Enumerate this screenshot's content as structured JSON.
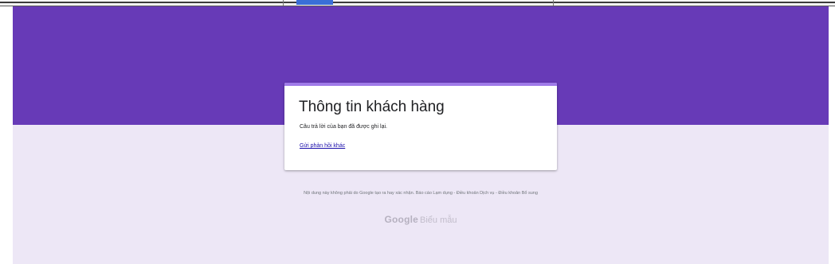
{
  "form": {
    "title": "Thông tin khách hàng",
    "confirmation_message": "Câu trả lời của bạn đã được ghi lại.",
    "resubmit_link": "Gửi phản hồi khác"
  },
  "footer": {
    "disclaimer_text": "Nội dung này không phải do Google tạo ra hay xác nhận.",
    "report_abuse": "Báo cáo Lạm dụng",
    "terms_of_service": "Điều khoản Dịch vụ",
    "additional_terms": "Điều khoản Bổ sung",
    "separator": " - ",
    "brand_google": "Google",
    "brand_product": "Biểu mẫu"
  },
  "colors": {
    "banner": "#673ab7",
    "page_background": "#ede7f6",
    "card_accent": "#9f7ae8",
    "link": "#1a0dab"
  }
}
